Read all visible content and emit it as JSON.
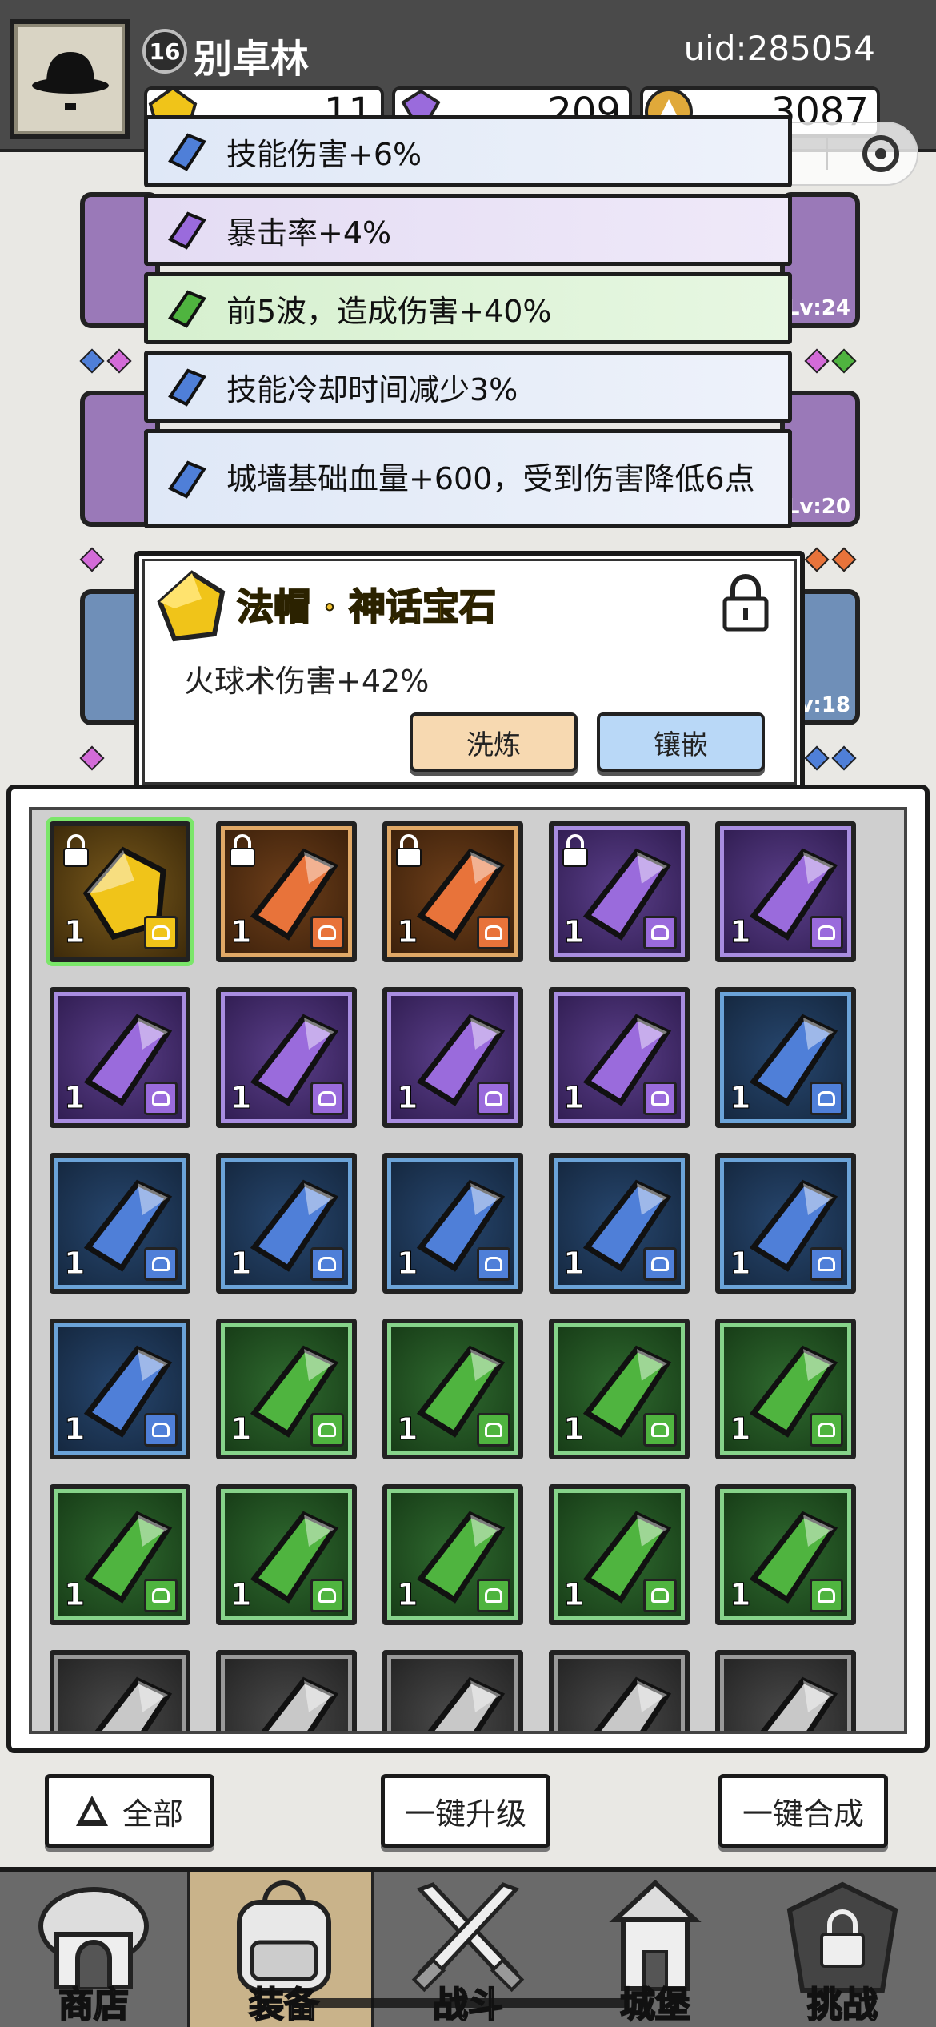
{
  "header": {
    "level": "16",
    "player_name": "别卓林",
    "uid": "uid:285054",
    "currencies": [
      {
        "icon": "gold-gem-icon",
        "value": "11"
      },
      {
        "icon": "purple-diamond-icon",
        "value": "209"
      },
      {
        "icon": "coin-icon",
        "value": "3087"
      }
    ]
  },
  "equipment_levels": [
    "Lv:24",
    "Lv:20",
    "v:18"
  ],
  "gem_stats": [
    {
      "gem": "blue",
      "text": "技能伤害+6%"
    },
    {
      "gem": "purple",
      "text": "暴击率+4%"
    },
    {
      "gem": "green",
      "text": "前5波，造成伤害+40%"
    },
    {
      "gem": "blue",
      "text": "技能冷却时间减少3%"
    },
    {
      "gem": "blue",
      "text": "城墙基础血量+600，受到伤害降低6点"
    }
  ],
  "popup": {
    "title": "法帽 · 神话宝石",
    "description": "火球术伤害+42%",
    "refine_label": "洗炼",
    "inlay_label": "镶嵌"
  },
  "inventory": [
    {
      "color": "gold",
      "qty": "1",
      "locked": true,
      "type": "ring"
    },
    {
      "color": "orange",
      "qty": "1",
      "locked": true,
      "type": "ring"
    },
    {
      "color": "orange",
      "qty": "1",
      "locked": true,
      "type": "boots"
    },
    {
      "color": "purple",
      "qty": "1",
      "locked": true,
      "type": "ring"
    },
    {
      "color": "purple",
      "qty": "1",
      "locked": false,
      "type": "armor"
    },
    {
      "color": "purple",
      "qty": "1",
      "locked": false,
      "type": "armor"
    },
    {
      "color": "purple",
      "qty": "1",
      "locked": false,
      "type": "hat"
    },
    {
      "color": "purple",
      "qty": "1",
      "locked": false,
      "type": "hat"
    },
    {
      "color": "purple",
      "qty": "1",
      "locked": false,
      "type": "necklace"
    },
    {
      "color": "blue",
      "qty": "1",
      "locked": false,
      "type": "ring"
    },
    {
      "color": "blue",
      "qty": "1",
      "locked": false,
      "type": "armor"
    },
    {
      "color": "blue",
      "qty": "1",
      "locked": false,
      "type": "staff"
    },
    {
      "color": "blue",
      "qty": "1",
      "locked": false,
      "type": "hat"
    },
    {
      "color": "blue",
      "qty": "1",
      "locked": false,
      "type": "hat"
    },
    {
      "color": "blue",
      "qty": "1",
      "locked": false,
      "type": "hat"
    },
    {
      "color": "blue",
      "qty": "1",
      "locked": false,
      "type": "necklace"
    },
    {
      "color": "green",
      "qty": "1",
      "locked": false,
      "type": "ring"
    },
    {
      "color": "green",
      "qty": "1",
      "locked": false,
      "type": "armor"
    },
    {
      "color": "green",
      "qty": "1",
      "locked": false,
      "type": "armor"
    },
    {
      "color": "green",
      "qty": "1",
      "locked": false,
      "type": "armor"
    },
    {
      "color": "green",
      "qty": "1",
      "locked": false,
      "type": "boots"
    },
    {
      "color": "green",
      "qty": "1",
      "locked": false,
      "type": "boots"
    },
    {
      "color": "green",
      "qty": "1",
      "locked": false,
      "type": "boots"
    },
    {
      "color": "green",
      "qty": "1",
      "locked": false,
      "type": "hat"
    },
    {
      "color": "green",
      "qty": "1",
      "locked": false,
      "type": "hat"
    },
    {
      "color": "gray",
      "qty": "",
      "locked": false,
      "type": ""
    },
    {
      "color": "gray",
      "qty": "",
      "locked": false,
      "type": ""
    },
    {
      "color": "gray",
      "qty": "",
      "locked": false,
      "type": ""
    },
    {
      "color": "gray",
      "qty": "",
      "locked": false,
      "type": ""
    },
    {
      "color": "gray",
      "qty": "",
      "locked": false,
      "type": ""
    }
  ],
  "actions": {
    "filter_label": "全部",
    "upgrade_all_label": "一键升级",
    "merge_all_label": "一键合成"
  },
  "tabs": [
    {
      "label": "商店",
      "icon": "shop-icon"
    },
    {
      "label": "装备",
      "icon": "backpack-icon"
    },
    {
      "label": "战斗",
      "icon": "crossed-swords-icon"
    },
    {
      "label": "城堡",
      "icon": "castle-icon"
    },
    {
      "label": "挑战",
      "icon": "locked-gate-icon"
    }
  ],
  "gem_colors": {
    "gold": "#f0c419",
    "orange": "#e8733a",
    "purple": "#9a6bdc",
    "blue": "#4f7fd8",
    "green": "#4fb43f",
    "gray": "#c8c8c8"
  }
}
